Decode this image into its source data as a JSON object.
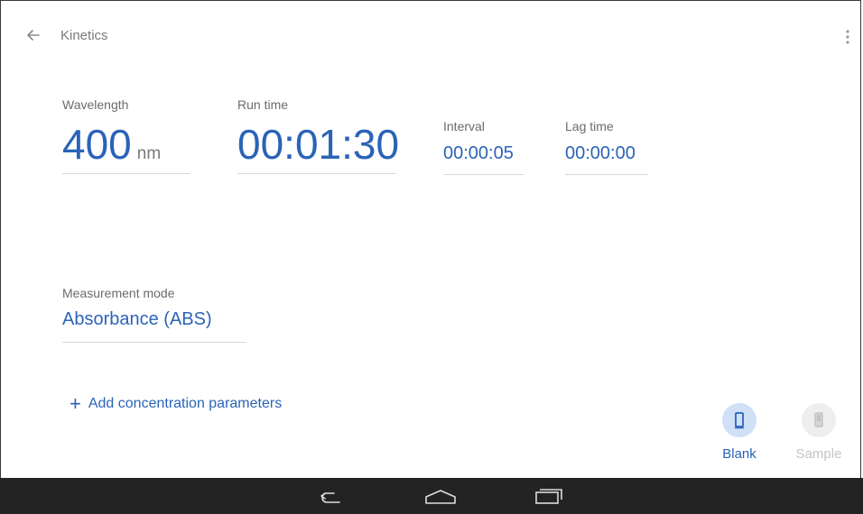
{
  "header": {
    "title": "Kinetics"
  },
  "fields": {
    "wavelength": {
      "label": "Wavelength",
      "value": "400",
      "unit": "nm"
    },
    "run_time": {
      "label": "Run time",
      "value": "00:01:30"
    },
    "interval": {
      "label": "Interval",
      "value": "00:00:05"
    },
    "lag_time": {
      "label": "Lag time",
      "value": "00:00:00"
    },
    "measurement_mode": {
      "label": "Measurement mode",
      "value": "Absorbance (ABS)"
    }
  },
  "add_link": {
    "icon": "plus-icon",
    "label": "Add concentration parameters"
  },
  "cuvettes": {
    "blank": {
      "label": "Blank",
      "icon": "cuvette-icon",
      "state": "active"
    },
    "sample": {
      "label": "Sample",
      "icon": "cuvette-icon",
      "state": "disabled"
    }
  },
  "colors": {
    "accent": "#2a63b8",
    "accent_light": "#cfe0f7",
    "navbar": "#232323"
  },
  "navbar": {
    "icons": [
      "back-icon",
      "home-icon",
      "recent-apps-icon"
    ]
  }
}
